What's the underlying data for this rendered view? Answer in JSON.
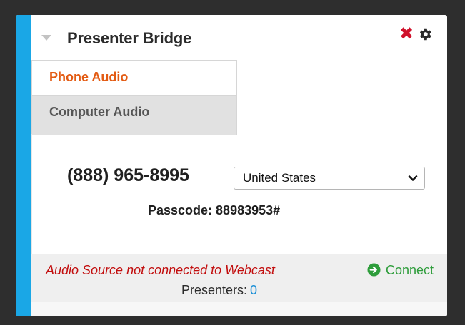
{
  "header": {
    "title": "Presenter Bridge",
    "close_icon": "close-icon",
    "settings_icon": "gear-icon",
    "collapse_icon": "collapse-caret-icon"
  },
  "tabs": [
    {
      "label": "Phone Audio",
      "active": true
    },
    {
      "label": "Computer Audio",
      "active": false
    }
  ],
  "phone": {
    "number": "(888) 965-8995",
    "country_selected": "United States",
    "passcode_label": "Passcode:",
    "passcode_value": "88983953#"
  },
  "footer": {
    "status": "Audio Source not connected to Webcast",
    "connect_label": "Connect",
    "presenters_label": "Presenters:",
    "presenters_count": "0"
  },
  "colors": {
    "accent": "#1aa7e6",
    "active_tab": "#e35b13",
    "status_error": "#c20e0e",
    "connect": "#2e9d3b",
    "link": "#1a8fd6",
    "close": "#d0112b"
  }
}
